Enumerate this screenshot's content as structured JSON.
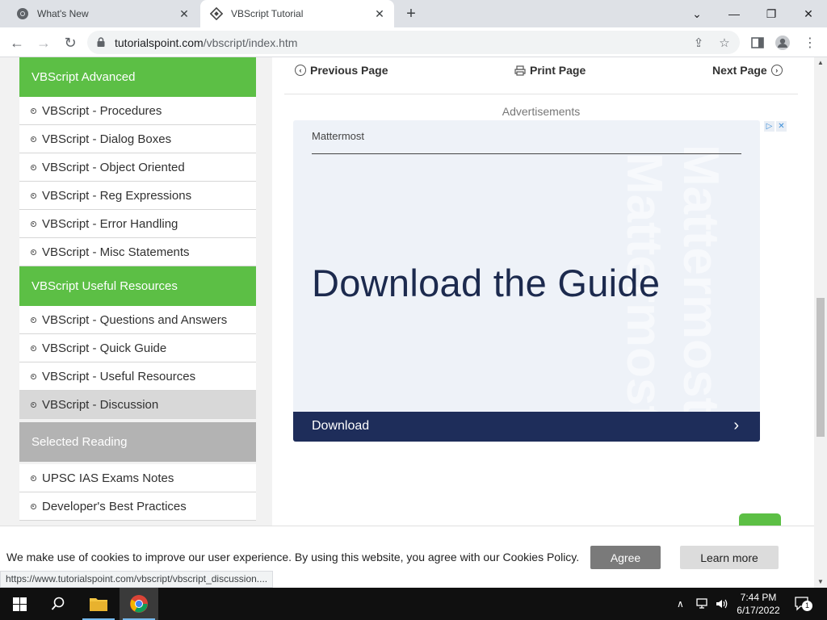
{
  "browser": {
    "tabs": [
      {
        "title": "What's New",
        "active": false
      },
      {
        "title": "VBScript Tutorial",
        "active": true
      }
    ],
    "url_domain": "tutorialspoint.com",
    "url_path": "/vbscript/index.htm",
    "status_url": "https://www.tutorialspoint.com/vbscript/vbscript_discussion...."
  },
  "sidebar": {
    "sections": [
      {
        "title": "VBScript Advanced",
        "items": [
          "VBScript - Procedures",
          "VBScript - Dialog Boxes",
          "VBScript - Object Oriented",
          "VBScript - Reg Expressions",
          "VBScript - Error Handling",
          "VBScript - Misc Statements"
        ]
      },
      {
        "title": "VBScript Useful Resources",
        "items": [
          "VBScript - Questions and Answers",
          "VBScript - Quick Guide",
          "VBScript - Useful Resources",
          "VBScript - Discussion"
        ]
      },
      {
        "title": "Selected Reading",
        "items": [
          "UPSC IAS Exams Notes",
          "Developer's Best Practices"
        ]
      }
    ]
  },
  "pagenav": {
    "previous": "Previous Page",
    "print": "Print Page",
    "next": "Next Page"
  },
  "ads": {
    "label": "Advertisements",
    "brand": "Mattermost",
    "headline": "Download the Guide",
    "cta": "Download",
    "watermark": "Mattermost"
  },
  "cookie": {
    "message": "We make use of cookies to improve our user experience. By using this website, you agree with our Cookies Policy.",
    "agree": "Agree",
    "learn_more": "Learn more"
  },
  "taskbar": {
    "time": "7:44 PM",
    "date": "6/17/2022",
    "notification_count": "1"
  },
  "colors": {
    "sidebar_green": "#5cbf45",
    "sidebar_gray": "#b3b3b3",
    "ad_navy": "#1e2d5a"
  }
}
